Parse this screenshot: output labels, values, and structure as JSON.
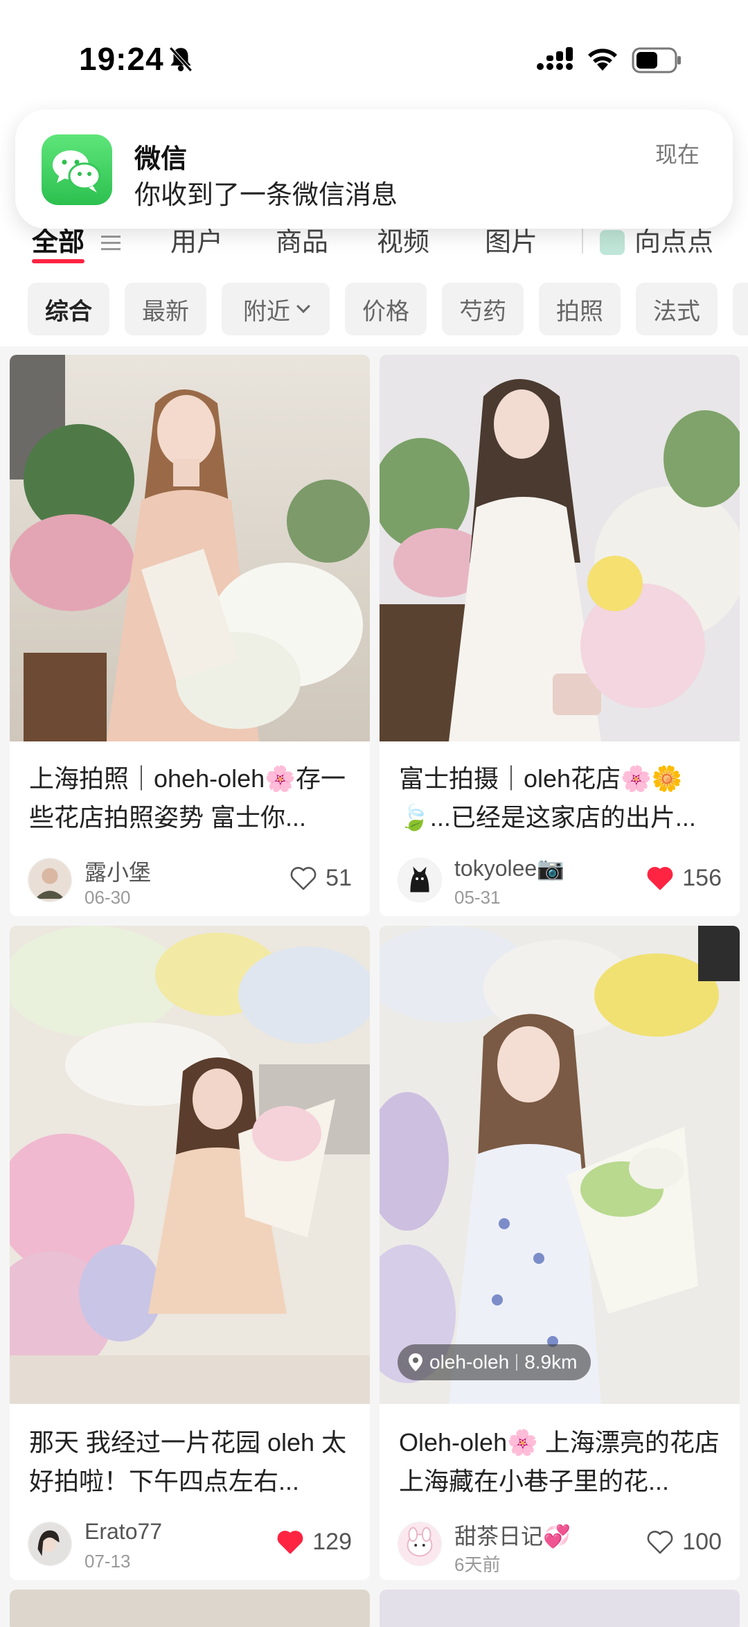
{
  "status": {
    "time": "19:24"
  },
  "notification": {
    "app": "微信",
    "message": "你收到了一条微信消息",
    "time": "现在"
  },
  "tabs": [
    {
      "label": "全部",
      "active": true
    },
    {
      "label": "用户"
    },
    {
      "label": "商品"
    },
    {
      "label": "视频"
    },
    {
      "label": "图片"
    },
    {
      "label": "向点点"
    }
  ],
  "filters": [
    {
      "label": "综合",
      "active": true
    },
    {
      "label": "最新"
    },
    {
      "label": "附近"
    },
    {
      "label": "价格"
    },
    {
      "label": "芍药"
    },
    {
      "label": "拍照"
    },
    {
      "label": "法式"
    }
  ],
  "accent": "#ff2442",
  "cards": [
    {
      "title": "上海拍照｜oheh-oleh🌸存一些花店拍照姿势 富士你...",
      "author": "露小堡",
      "date": "06-30",
      "likes": "51",
      "liked": false
    },
    {
      "title": "富士拍摄｜oleh花店🌸🌼🍃...已经是这家店的出片...",
      "author": "tokyolee📷",
      "date": "05-31",
      "likes": "156",
      "liked": true
    },
    {
      "title": "那天 我经过一片花园 oleh 太好拍啦！下午四点左右...",
      "author": "Erato77",
      "date": "07-13",
      "likes": "129",
      "liked": true
    },
    {
      "title": "Oleh-oleh🌸 上海漂亮的花店 上海藏在小巷子里的花...",
      "author": "甜茶日记💞",
      "date": "6天前",
      "likes": "100",
      "liked": false,
      "location": "oleh-oleh",
      "distance": "8.9km"
    }
  ]
}
